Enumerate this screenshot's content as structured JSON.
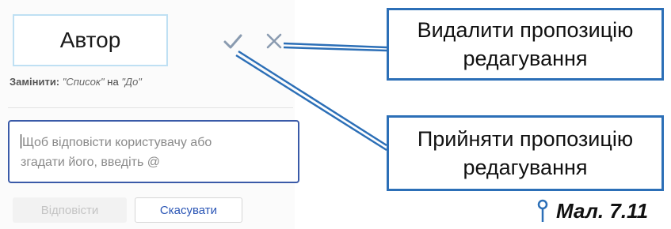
{
  "suggestion": {
    "text": "Автор",
    "replace_label": "Замінити:",
    "replace_from": "\"Список\"",
    "replace_on": "на",
    "replace_to": "\"До\""
  },
  "reply": {
    "placeholder_line1": "Щоб відповісти користувачу або",
    "placeholder_line2": "згадати його, введіть @"
  },
  "buttons": {
    "reply_label": "Відповісти",
    "cancel_label": "Скасувати"
  },
  "callouts": {
    "delete_line1": "Видалити пропозицію",
    "delete_line2": "редагування",
    "accept_line1": "Прийняти пропозицію",
    "accept_line2": "редагування"
  },
  "figure": {
    "caption": "Мал. 7.11"
  },
  "colors": {
    "accent": "#2c6fb7",
    "input_border": "#3a5aa8",
    "cancel_text": "#2a55b5",
    "icon_gray": "#8a9bb0"
  },
  "icons": [
    "check-icon",
    "close-icon",
    "location-pin-icon"
  ]
}
